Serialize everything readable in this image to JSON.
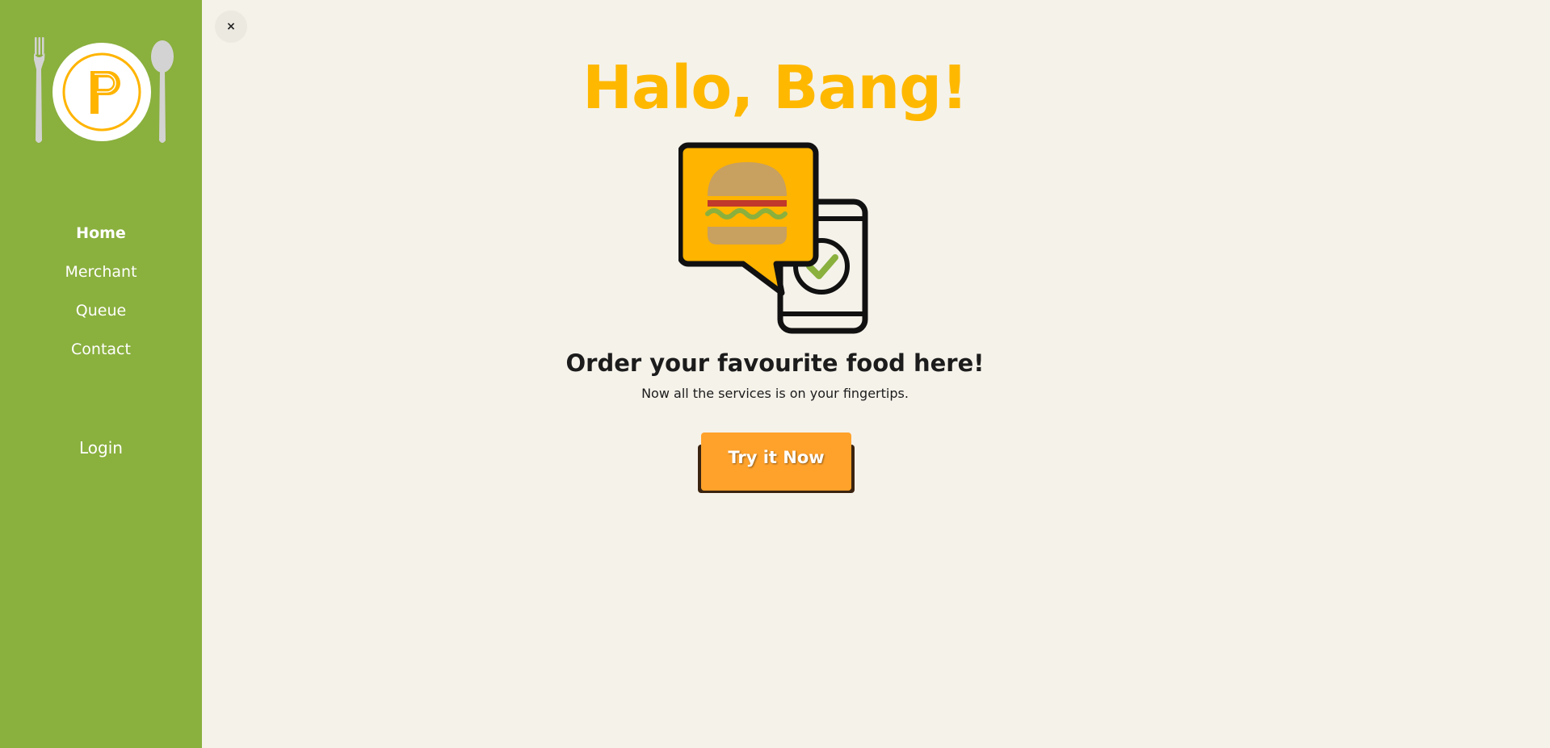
{
  "sidebar": {
    "logo_letter": "P",
    "nav": [
      {
        "label": "Home",
        "active": true
      },
      {
        "label": "Merchant",
        "active": false
      },
      {
        "label": "Queue",
        "active": false
      },
      {
        "label": "Contact",
        "active": false
      }
    ],
    "login_label": "Login"
  },
  "close_button": {
    "label": "×"
  },
  "hero": {
    "title": "Halo, Bang!",
    "subtitle": "Order your favourite food here!",
    "tagline": "Now all the services is on your fingertips.",
    "cta_label": "Try it Now"
  },
  "icons": {
    "logo": "plate-fork-spoon-logo-icon",
    "hero": "burger-chat-phone-check-icon",
    "close": "close-icon"
  },
  "colors": {
    "sidebar_bg": "#8ab03e",
    "page_bg": "#f5f2ea",
    "title": "#ffb800",
    "cta": "#ffa22b",
    "accent_green": "#8ab03e"
  }
}
